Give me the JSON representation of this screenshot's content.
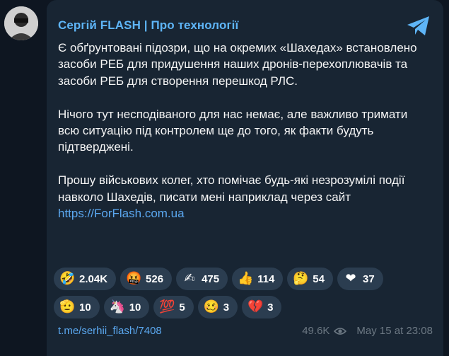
{
  "channel": {
    "name": "Сергій FLASH | Про технології"
  },
  "post": {
    "paragraph1": "Є обґрунтовані підозри, що на окремих «Шахедах» встановлено засоби РЕБ для придушення наших дронів-перехоплювачів та засоби РЕБ для створення перешкод РЛС.",
    "paragraph2": "Нічого тут несподіваного для нас немає, але важливо тримати всю ситуацію під контролем ще до того, як факти будуть підтверджені.",
    "paragraph3": "Прошу військових колег, хто помічає будь-які незрозумілі події навколо Шахедів, писати мені наприклад через сайт ",
    "link": "https://ForFlash.com.ua"
  },
  "reactions": [
    {
      "emoji": "🤣",
      "count": "2.04K",
      "icon": "rofl-icon"
    },
    {
      "emoji": "🤬",
      "count": "526",
      "icon": "cursing-face-icon"
    },
    {
      "emoji": "✍",
      "count": "475",
      "icon": "writing-hand-icon"
    },
    {
      "emoji": "👍",
      "count": "114",
      "icon": "thumbs-up-icon"
    },
    {
      "emoji": "🤔",
      "count": "54",
      "icon": "thinking-face-icon"
    },
    {
      "emoji": "❤",
      "count": "37",
      "icon": "red-heart-icon"
    },
    {
      "emoji": "🫡",
      "count": "10",
      "icon": "salute-icon"
    },
    {
      "emoji": "🦄",
      "count": "10",
      "icon": "unicorn-icon"
    },
    {
      "emoji": "💯",
      "count": "5",
      "icon": "hundred-points-icon"
    },
    {
      "emoji": "🥴",
      "count": "3",
      "icon": "woozy-face-icon"
    },
    {
      "emoji": "💔",
      "count": "3",
      "icon": "broken-heart-icon"
    }
  ],
  "footer": {
    "post_link": "t.me/serhii_flash/7408",
    "views": "49.6K",
    "date": "May 15 at 23:08"
  },
  "colors": {
    "background": "#0e1621",
    "bubble": "#182533",
    "accent": "#5eb5f7",
    "chip": "#2b3d50"
  }
}
